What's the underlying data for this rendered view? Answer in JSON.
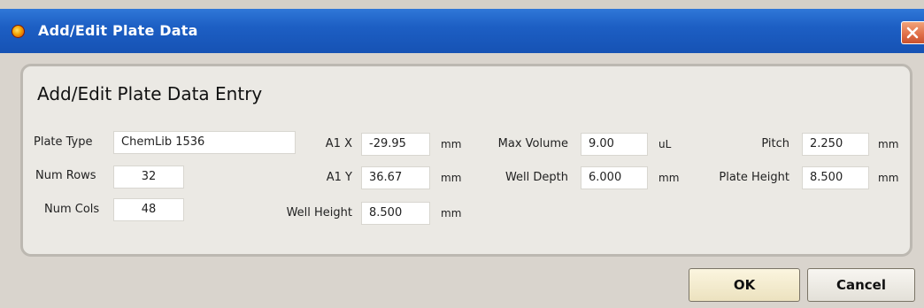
{
  "window": {
    "title": "Add/Edit Plate Data"
  },
  "form": {
    "heading": "Add/Edit Plate Data Entry",
    "plate_type": {
      "label": "Plate Type",
      "value": "ChemLib 1536"
    },
    "num_rows": {
      "label": "Num Rows",
      "value": "32"
    },
    "num_cols": {
      "label": "Num Cols",
      "value": "48"
    },
    "a1x": {
      "label": "A1 X",
      "value": "-29.95",
      "unit": "mm"
    },
    "a1y": {
      "label": "A1 Y",
      "value": "36.67",
      "unit": "mm"
    },
    "well_height": {
      "label": "Well Height",
      "value": "8.500",
      "unit": "mm"
    },
    "max_volume": {
      "label": "Max Volume",
      "value": "9.00",
      "unit": "uL"
    },
    "well_depth": {
      "label": "Well Depth",
      "value": "6.000",
      "unit": "mm"
    },
    "pitch": {
      "label": "Pitch",
      "value": "2.250",
      "unit": "mm"
    },
    "plate_height": {
      "label": "Plate Height",
      "value": "8.500",
      "unit": "mm"
    }
  },
  "buttons": {
    "ok": "OK",
    "cancel": "Cancel"
  },
  "icons": {
    "app": "app-icon",
    "close": "close-icon"
  },
  "colors": {
    "titlebar": "#1d5fc4",
    "close": "#e1714a",
    "ok_button": "#f3ecd0"
  }
}
